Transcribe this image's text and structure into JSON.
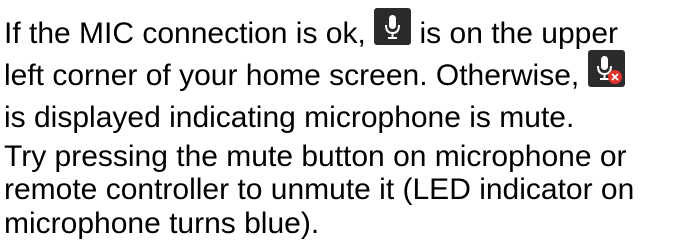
{
  "lines": {
    "l1_a": "If the MIC connection is ok, ",
    "l1_b": " is on the upper",
    "l2_a": "left corner of your home screen. Otherwise, ",
    "l3": "is displayed indicating microphone is mute.",
    "l4": "Try pressing the mute button on microphone or",
    "l5": "remote controller to unmute it (LED indicator on",
    "l6": "microphone turns blue)."
  },
  "icons": {
    "mic_on": "microphone-icon",
    "mic_muted": "microphone-muted-icon"
  },
  "colors": {
    "text": "#000000",
    "icon_bg": "#2b2b2b",
    "icon_glyph": "#ffffff",
    "mute_badge": "#e0322a"
  }
}
